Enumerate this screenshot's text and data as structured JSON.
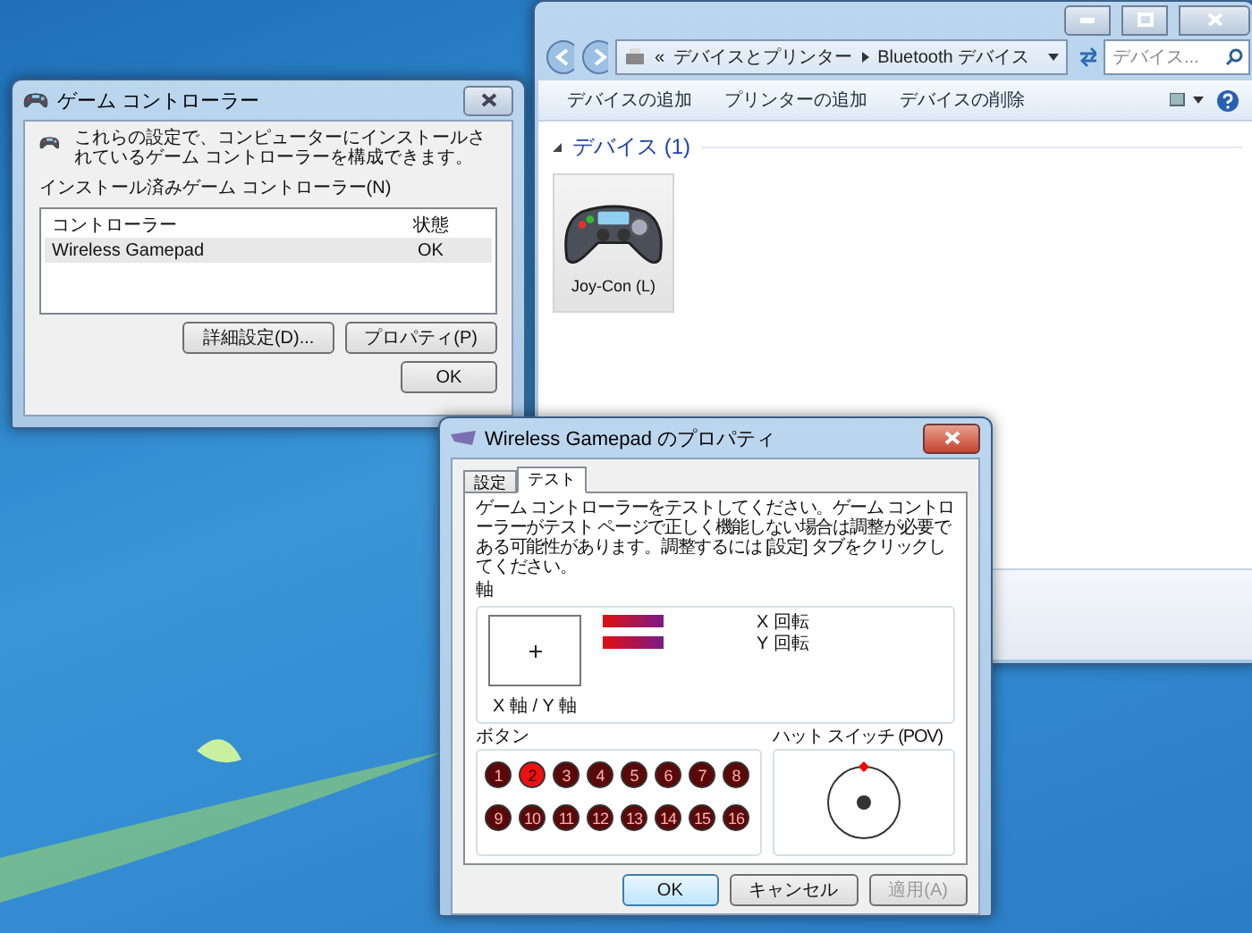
{
  "explorer": {
    "address_chevron": "«",
    "address": [
      "デバイスとプリンター",
      "Bluetooth デバイス"
    ],
    "search": {
      "placeholder": "デバイス..."
    },
    "toolbar": [
      "デバイスの追加",
      "プリンターの追加",
      "デバイスの削除"
    ],
    "group": {
      "title": "デバイス (1)",
      "expanded": true
    },
    "devices": [
      {
        "name": "Joy-Con (L)",
        "selected": true
      }
    ]
  },
  "game_controllers": {
    "title": "ゲーム コントローラー",
    "description": "これらの設定で、コンピューターにインストールされているゲーム コントローラーを構成できます。",
    "list_label": "インストール済みゲーム コントローラー(N)",
    "columns": [
      "コントローラー",
      "状態"
    ],
    "rows": [
      {
        "cells": [
          "Wireless Gamepad",
          "OK"
        ],
        "selected": true
      }
    ],
    "buttons": [
      "詳細設定(D)...",
      "プロパティ(P)"
    ],
    "ok": "OK"
  },
  "properties": {
    "title": "Wireless Gamepad のプロパティ",
    "tabs": [
      {
        "label": "設定",
        "selected": false
      },
      {
        "label": "テスト",
        "selected": true
      }
    ],
    "instructions": "ゲーム コントローラーをテストしてください。ゲーム コントローラーがテスト ページで正しく機能しない場合は調整が必要である可能性があります。調整するには [設定] タブをクリックしてください。",
    "axes": {
      "label": "軸",
      "xy_label": "X 軸 / Y 軸",
      "rotations": [
        {
          "label": "X 回転",
          "level": 1
        },
        {
          "label": "Y 回転",
          "level": 1
        }
      ]
    },
    "buttons_group": {
      "label": "ボタン",
      "buttons": [
        {
          "label": "1",
          "pressed": false
        },
        {
          "label": "2",
          "pressed": true
        },
        {
          "label": "3",
          "pressed": false
        },
        {
          "label": "4",
          "pressed": false
        },
        {
          "label": "5",
          "pressed": false
        },
        {
          "label": "6",
          "pressed": false
        },
        {
          "label": "7",
          "pressed": false
        },
        {
          "label": "8",
          "pressed": false
        },
        {
          "label": "9",
          "pressed": false
        },
        {
          "label": "10",
          "pressed": false
        },
        {
          "label": "11",
          "pressed": false
        },
        {
          "label": "12",
          "pressed": false
        },
        {
          "label": "13",
          "pressed": false
        },
        {
          "label": "14",
          "pressed": false
        },
        {
          "label": "15",
          "pressed": false
        },
        {
          "label": "16",
          "pressed": false
        }
      ]
    },
    "pov": {
      "label": "ハット スイッチ (POV)",
      "up_pressed": true
    },
    "actions": [
      {
        "label": "OK",
        "disabled": false
      },
      {
        "label": "キャンセル",
        "disabled": false
      },
      {
        "label": "適用(A)",
        "disabled": true
      }
    ]
  }
}
